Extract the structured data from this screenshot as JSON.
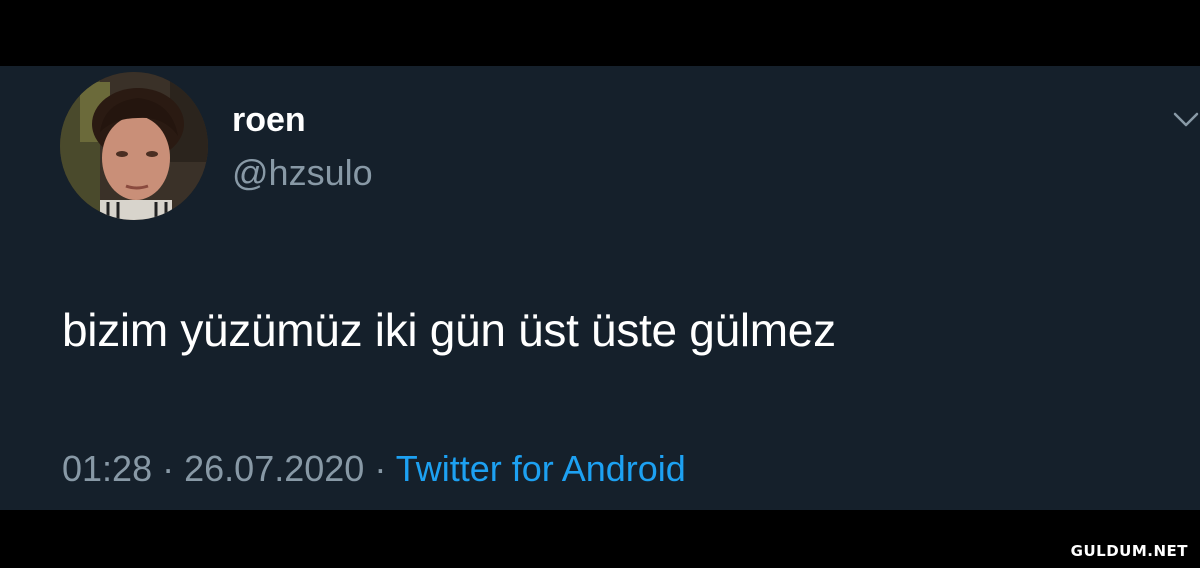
{
  "tweet": {
    "author": {
      "display_name": "roen",
      "handle": "@hzsulo",
      "avatar_icon": "profile-photo"
    },
    "text": "bizim yüzümüz iki gün üst üste gülmez",
    "time": "01:28",
    "separator": "·",
    "date": "26.07.2020",
    "source": "Twitter for Android",
    "menu_icon": "chevron-down-icon"
  },
  "watermark": "GULDUM.NET",
  "colors": {
    "card_background": "#15202b",
    "frame_background": "#000000",
    "primary_text": "#ffffff",
    "secondary_text": "#8899a6",
    "link_accent": "#1da1f2"
  }
}
